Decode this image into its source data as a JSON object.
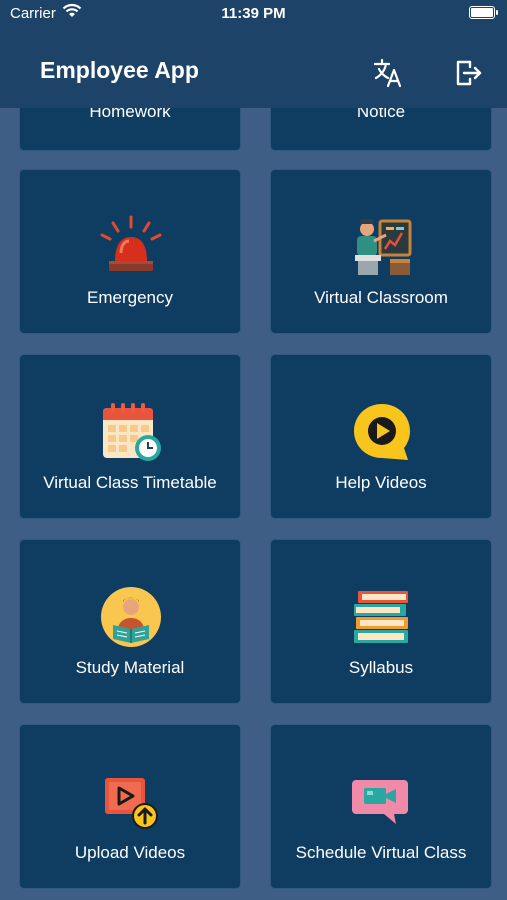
{
  "status": {
    "carrier": "Carrier",
    "time": "11:39 PM"
  },
  "header": {
    "title": "Employee App",
    "translate_icon": "translate-icon",
    "logout_icon": "logout-icon"
  },
  "tiles": [
    {
      "label": "Homework",
      "icon": "homework-icon"
    },
    {
      "label": "Notice",
      "icon": "notice-icon"
    },
    {
      "label": "Emergency",
      "icon": "emergency-siren-icon"
    },
    {
      "label": "Virtual Classroom",
      "icon": "teacher-board-icon"
    },
    {
      "label": "Virtual Class Timetable",
      "icon": "calendar-clock-icon"
    },
    {
      "label": "Help Videos",
      "icon": "play-chat-icon"
    },
    {
      "label": "Study Material",
      "icon": "student-reading-icon"
    },
    {
      "label": "Syllabus",
      "icon": "book-stack-icon"
    },
    {
      "label": "Upload Videos",
      "icon": "video-upload-icon"
    },
    {
      "label": "Schedule Virtual Class",
      "icon": "video-chat-icon"
    }
  ],
  "colors": {
    "header": "#1d4468",
    "background": "#3f5e86",
    "tile": "#0f3d62"
  }
}
